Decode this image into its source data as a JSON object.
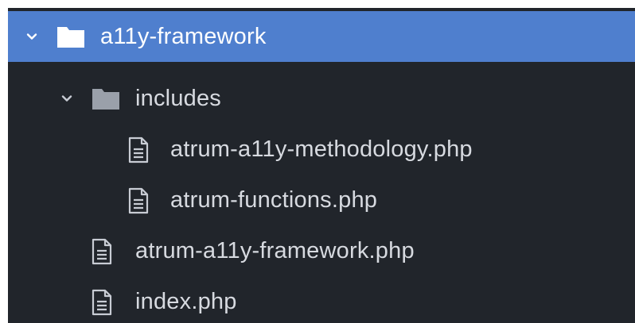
{
  "tree": {
    "root": {
      "label": "a11y-framework",
      "icon": "folder-open-icon",
      "expanded": true,
      "selected": true
    },
    "folder_includes": {
      "label": "includes",
      "icon": "folder-icon",
      "expanded": true
    },
    "files": {
      "methodology": {
        "label": "atrum-a11y-methodology.php",
        "icon": "file-text-icon"
      },
      "functions": {
        "label": "atrum-functions.php",
        "icon": "file-text-icon"
      },
      "framework": {
        "label": "atrum-a11y-framework.php",
        "icon": "file-text-icon"
      },
      "index": {
        "label": "index.php",
        "icon": "file-text-icon"
      }
    }
  },
  "colors": {
    "background": "#21252b",
    "selection": "#4f7fce",
    "text": "#d7dae0",
    "icon": "#c8ccd4",
    "folder_muted": "#9aa0aa"
  }
}
